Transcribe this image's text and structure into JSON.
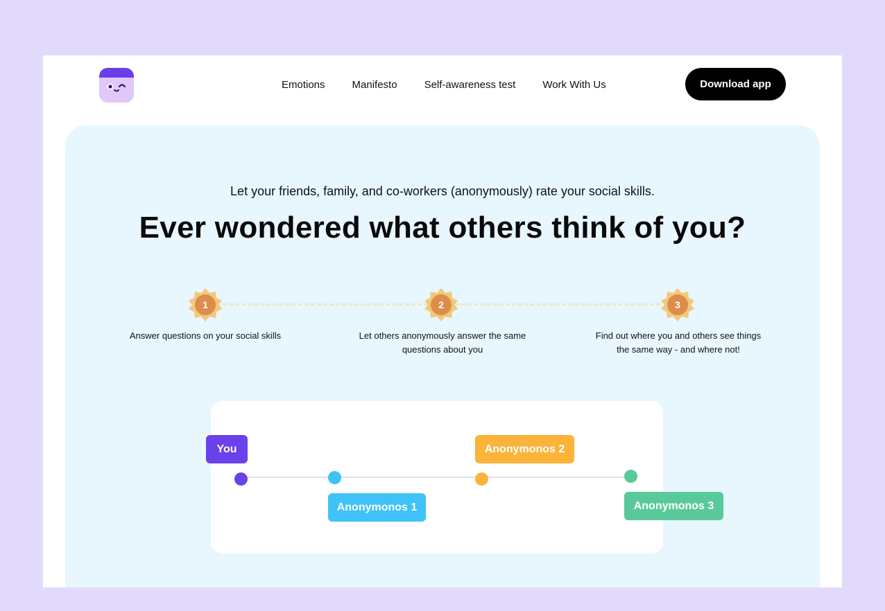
{
  "nav": {
    "items": [
      "Emotions",
      "Manifesto",
      "Self-awareness test",
      "Work With Us"
    ],
    "download_label": "Download app"
  },
  "hero": {
    "subtitle": "Let your friends, family, and co-workers (anonymously) rate your social skills.",
    "headline": "Ever wondered what others think of you?"
  },
  "steps": [
    {
      "number": "1",
      "text": "Answer questions on your social skills"
    },
    {
      "number": "2",
      "text": "Let others anonymously answer the same questions about you"
    },
    {
      "number": "3",
      "text": "Find out where you and others see things the same way - and where not!"
    }
  ],
  "comparison": {
    "you": {
      "label": "You",
      "color": "#6a41ea"
    },
    "anon1": {
      "label": "Anonymonos 1",
      "color": "#3fc2f8"
    },
    "anon2": {
      "label": "Anonymonos 2",
      "color": "#fbb33a"
    },
    "anon3": {
      "label": "Anonymonos 3",
      "color": "#5ac99a"
    }
  },
  "colors": {
    "background": "#e2dafb",
    "panel": "#e8f6fe",
    "badge_outer": "#f0c97a",
    "badge_inner": "#dd8d4b"
  }
}
